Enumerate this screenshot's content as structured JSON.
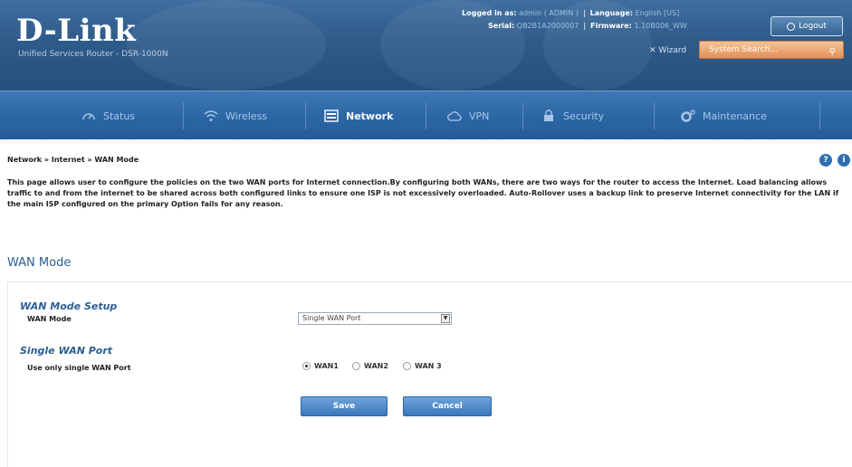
{
  "header": {
    "brand": "D-Link",
    "product": "Unified Services Router - DSR-1000N",
    "logged_in_label": "Logged in as:",
    "logged_in_value": "admin ( ADMIN )",
    "language_label": "Language:",
    "language_value": "English [US]",
    "serial_label": "Serial:",
    "serial_value": "QB2B1A2000007",
    "firmware_label": "Firmware:",
    "firmware_value": "1.10B006_WW",
    "logout_label": "Logout",
    "wizard_label": "Wizard",
    "search_placeholder": "System Search..."
  },
  "nav": {
    "items": [
      {
        "label": "Status",
        "icon": "gauge-icon"
      },
      {
        "label": "Wireless",
        "icon": "wifi-icon"
      },
      {
        "label": "Network",
        "icon": "network-icon",
        "active": true
      },
      {
        "label": "VPN",
        "icon": "cloud-icon"
      },
      {
        "label": "Security",
        "icon": "lock-icon"
      },
      {
        "label": "Maintenance",
        "icon": "gear-icon"
      }
    ]
  },
  "breadcrumb": "Network  »  Internet  »  WAN Mode",
  "description": "This page allows user to configure the policies on the two WAN ports for Internet connection.By configuring both WANs, there are two ways for the router to access the Internet. Load balancing allows traffic to and from the internet to be shared across both configured links to ensure one ISP is not excessively overloaded. Auto-Rollover uses a backup link to preserve Internet connectivity for the LAN if the main ISP configured on the primary Option fails for any reason.",
  "page_title": "WAN Mode",
  "form": {
    "setup_title": "WAN Mode Setup",
    "wan_mode_label": "WAN Mode",
    "wan_mode_value": "Single WAN Port",
    "single_title": "Single WAN Port",
    "single_label": "Use only single WAN Port",
    "radios": [
      {
        "label": "WAN1",
        "checked": true
      },
      {
        "label": "WAN2",
        "checked": false
      },
      {
        "label": "WAN 3",
        "checked": false
      }
    ],
    "save_label": "Save",
    "cancel_label": "Cancel"
  }
}
